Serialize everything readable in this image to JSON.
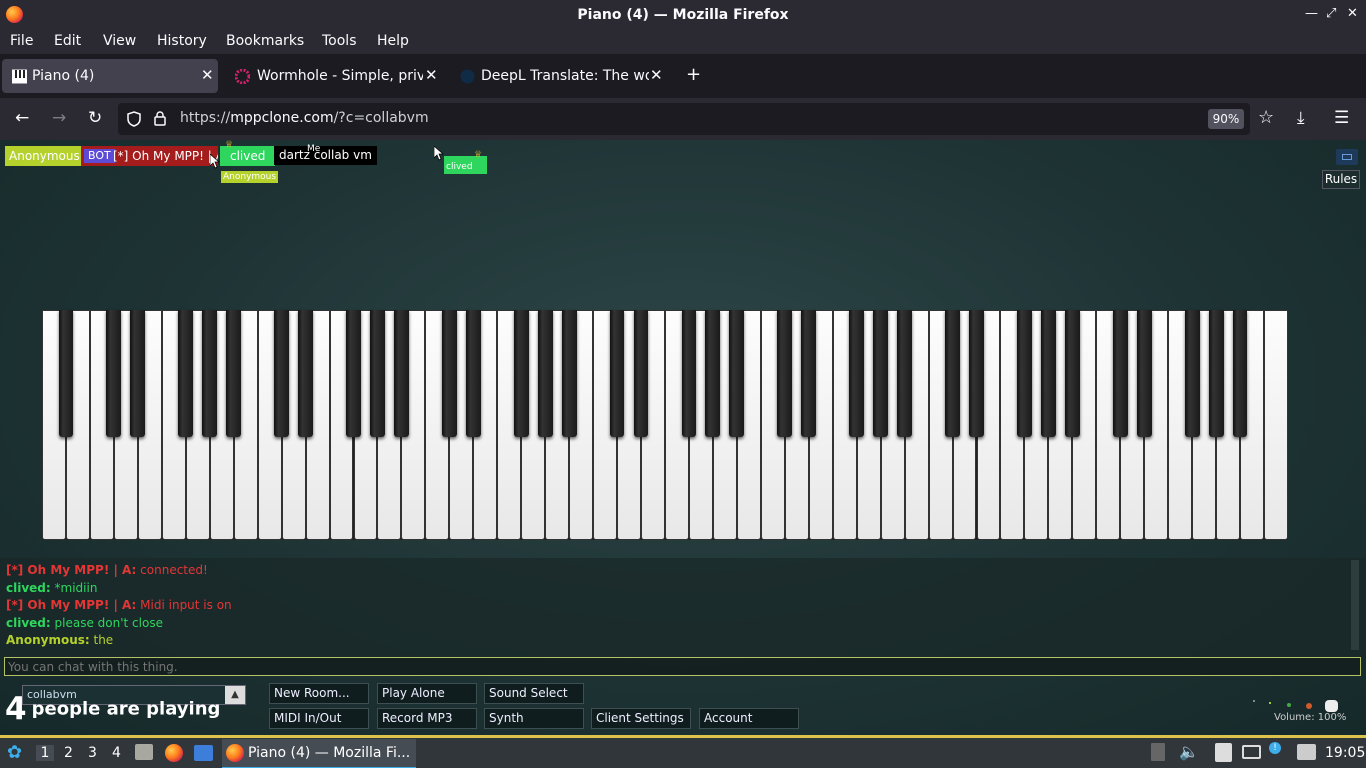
{
  "window": {
    "title": "Piano (4) — Mozilla Firefox"
  },
  "menubar": [
    "File",
    "Edit",
    "View",
    "History",
    "Bookmarks",
    "Tools",
    "Help"
  ],
  "tabs": [
    {
      "label": "Piano (4)",
      "active": true
    },
    {
      "label": "Wormhole - Simple, priva",
      "active": false
    },
    {
      "label": "DeepL Translate: The wor",
      "active": false
    }
  ],
  "nav": {
    "url_prefix": "https://",
    "url_domain": "mppclone.com",
    "url_path": "/?c=collabvm",
    "zoom": "90%"
  },
  "participants": [
    {
      "label": "Anonymous",
      "color": "#b5d12b"
    },
    {
      "label": "BOT",
      "color": "#5d4bd6"
    },
    {
      "label": "[*] Oh My MPP! | A",
      "color": "#a51c1c"
    },
    {
      "label": "clived",
      "color": "#2ed65e"
    }
  ],
  "cursors": {
    "anonymous_tag": "Anonymous",
    "me_tag": "Me",
    "clived_tag": "clived"
  },
  "room_title": "dartz collab vm",
  "rules_label": "Rules",
  "chat": [
    {
      "who": "[*] Oh My MPP! | A:",
      "msg": "connected!",
      "color": "#e53535"
    },
    {
      "who": "clived:",
      "msg": "*midiin",
      "color": "#2ed65e"
    },
    {
      "who": "[*] Oh My MPP! | A:",
      "msg": "Midi input is on",
      "color": "#e53535"
    },
    {
      "who": "clived:",
      "msg": "please don't close",
      "color": "#2ed65e"
    },
    {
      "who": "Anonymous:",
      "msg": "the",
      "color": "#b5d12b"
    }
  ],
  "chat_placeholder": "You can chat with this thing.",
  "room_select": "collabvm",
  "people": {
    "count": "4",
    "text": "people are playing"
  },
  "controls": {
    "new_room": "New Room...",
    "play_alone": "Play Alone",
    "sound_select": "Sound Select",
    "midi": "MIDI In/Out",
    "record": "Record MP3",
    "synth": "Synth",
    "client_settings": "Client Settings",
    "account": "Account"
  },
  "volume": "Volume: 100%",
  "taskbar": {
    "desktops": [
      "1",
      "2",
      "3",
      "4"
    ],
    "task_label": "Piano (4) — Mozilla Fi...",
    "clock": "19:05"
  },
  "colors": {
    "accent": "#3daee9",
    "taskbar_border": "#dcc34d"
  }
}
